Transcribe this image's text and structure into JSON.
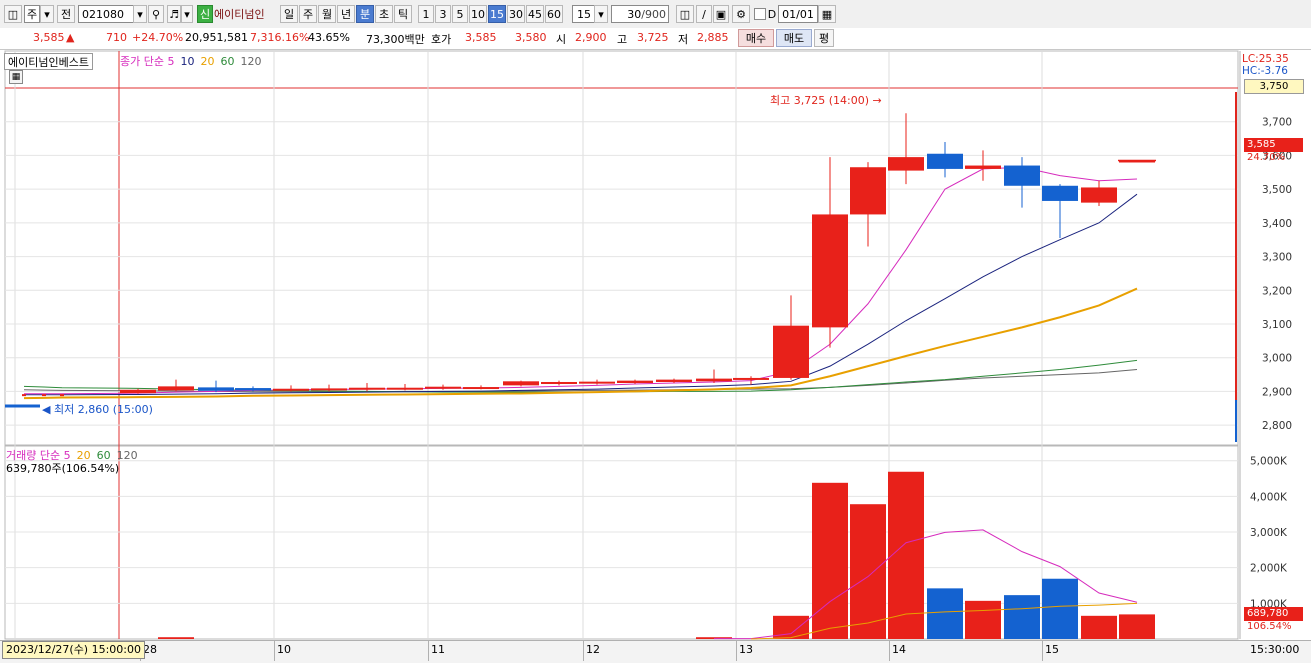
{
  "toolbar": {
    "market": "주",
    "prev_label": "전",
    "code": "021080",
    "badge": "신",
    "stock_name": "에이티넘인",
    "periods": [
      "일",
      "주",
      "월",
      "년",
      "분",
      "초",
      "틱"
    ],
    "selected_period": "분",
    "intervals": [
      "1",
      "3",
      "5",
      "10",
      "15",
      "30",
      "45",
      "60"
    ],
    "selected_interval": "15",
    "interval_select": "15",
    "count": "30",
    "count_max": "/900",
    "d_label": "D",
    "date": "01/01"
  },
  "quote": {
    "price": "3,585",
    "arrow": "▲",
    "change": "710",
    "change_pct": "+24.70%",
    "volume": "20,951,581",
    "volume_pct": "7,316.16%",
    "turnover": "43.65%",
    "amount": "73,300백만",
    "hoga_label": "호가",
    "ask": "3,585",
    "bid": "3,580",
    "open_label": "시",
    "open": "2,900",
    "high_label": "고",
    "high": "3,725",
    "low_label": "저",
    "low": "2,885",
    "buy_label": "매수",
    "sell_label": "매도",
    "eval_label": "평"
  },
  "price_panel": {
    "title": "에이티넘인베스트",
    "legend": {
      "name": "종가 단순",
      "periods": [
        "5",
        "10",
        "20",
        "60",
        "120"
      ]
    },
    "lc": "LC:25.35",
    "hc": "HC:-3.76",
    "top_box": "3,750",
    "price_tag": "3,585",
    "pct_tag": "24.70%",
    "high_note": "최고 3,725 (14:00)",
    "low_note": "최저 2,860 (15:00)"
  },
  "volume_panel": {
    "legend": {
      "name": "거래량",
      "method": "단순",
      "periods": [
        "5",
        "20",
        "60",
        "120"
      ]
    },
    "current": "639,780주(106.54%)",
    "tag": "689,780",
    "pct": "106.54%"
  },
  "xaxis": {
    "cursor_label": "2023/12/27(수) 15:00:00",
    "first_day": "28",
    "end_time": "15:30:00"
  },
  "colors": {
    "up": "#e8211a",
    "down": "#1462d0",
    "ma5": "#d62bbd",
    "ma10": "#1a237e",
    "ma20": "#e8a000",
    "ma60": "#2e8b3a",
    "ma120": "#666666"
  },
  "chart_data": [
    {
      "type": "candlestick",
      "title": "에이티넘인베스트",
      "ylim": [
        2750,
        3800
      ],
      "y_ticks": [
        2800,
        2900,
        3000,
        3100,
        3200,
        3300,
        3400,
        3500,
        3600,
        3700
      ],
      "x_ticks": [
        "28",
        "10",
        "11",
        "12",
        "13",
        "14",
        "15"
      ],
      "candles": [
        {
          "o": 2892,
          "c": 2892,
          "h": 2892,
          "l": 2892
        },
        {
          "o": 2892,
          "c": 2892,
          "h": 2892,
          "l": 2892
        },
        {
          "o": 2892,
          "c": 2892,
          "h": 2892,
          "l": 2892
        },
        {
          "o": 2895,
          "c": 2905,
          "h": 2908,
          "l": 2893
        },
        {
          "o": 2903,
          "c": 2915,
          "h": 2935,
          "l": 2900
        },
        {
          "o": 2912,
          "c": 2902,
          "h": 2932,
          "l": 2898
        },
        {
          "o": 2910,
          "c": 2903,
          "h": 2915,
          "l": 2900
        },
        {
          "o": 2905,
          "c": 2908,
          "h": 2918,
          "l": 2900
        },
        {
          "o": 2905,
          "c": 2909,
          "h": 2920,
          "l": 2900
        },
        {
          "o": 2905,
          "c": 2911,
          "h": 2925,
          "l": 2900
        },
        {
          "o": 2907,
          "c": 2911,
          "h": 2922,
          "l": 2903
        },
        {
          "o": 2910,
          "c": 2914,
          "h": 2920,
          "l": 2905
        },
        {
          "o": 2910,
          "c": 2913,
          "h": 2918,
          "l": 2906
        },
        {
          "o": 2918,
          "c": 2930,
          "h": 2932,
          "l": 2915
        },
        {
          "o": 2922,
          "c": 2928,
          "h": 2932,
          "l": 2918
        },
        {
          "o": 2925,
          "c": 2929,
          "h": 2935,
          "l": 2920
        },
        {
          "o": 2925,
          "c": 2932,
          "h": 2935,
          "l": 2922
        },
        {
          "o": 2928,
          "c": 2935,
          "h": 2938,
          "l": 2925
        },
        {
          "o": 2930,
          "c": 2938,
          "h": 2965,
          "l": 2925
        },
        {
          "o": 2935,
          "c": 2940,
          "h": 2945,
          "l": 2920
        },
        {
          "o": 2940,
          "c": 3095,
          "h": 3185,
          "l": 2935
        },
        {
          "o": 3090,
          "c": 3425,
          "h": 3595,
          "l": 3030
        },
        {
          "o": 3425,
          "c": 3565,
          "h": 3580,
          "l": 3330
        },
        {
          "o": 3555,
          "c": 3595,
          "h": 3725,
          "l": 3515
        },
        {
          "o": 3605,
          "c": 3560,
          "h": 3640,
          "l": 3535
        },
        {
          "o": 3560,
          "c": 3570,
          "h": 3615,
          "l": 3525
        },
        {
          "o": 3570,
          "c": 3510,
          "h": 3595,
          "l": 3445
        },
        {
          "o": 3510,
          "c": 3465,
          "h": 3515,
          "l": 3355
        },
        {
          "o": 3460,
          "c": 3505,
          "h": 3525,
          "l": 3450
        },
        {
          "o": 3585,
          "c": 3585,
          "h": 3585,
          "l": 3585
        }
      ],
      "ma": {
        "ma5": [
          2893,
          2893,
          2893,
          2895,
          2898,
          2900,
          2903,
          2905,
          2906,
          2907,
          2908,
          2909,
          2910,
          2912,
          2915,
          2918,
          2922,
          2925,
          2928,
          2932,
          2960,
          3040,
          3160,
          3320,
          3500,
          3560,
          3565,
          3540,
          3525,
          3530
        ],
        "ma10": [
          2890,
          2890,
          2890,
          2891,
          2892,
          2893,
          2895,
          2896,
          2897,
          2898,
          2899,
          2900,
          2901,
          2903,
          2905,
          2907,
          2910,
          2913,
          2916,
          2920,
          2930,
          2975,
          3040,
          3110,
          3175,
          3240,
          3300,
          3350,
          3400,
          3485
        ],
        "ma20": [
          2880,
          2881,
          2882,
          2883,
          2884,
          2885,
          2887,
          2888,
          2889,
          2890,
          2891,
          2892,
          2893,
          2894,
          2896,
          2898,
          2900,
          2903,
          2906,
          2910,
          2918,
          2945,
          2975,
          3005,
          3035,
          3062,
          3090,
          3120,
          3155,
          3205
        ],
        "ma60": [
          2915,
          2913,
          2911,
          2909,
          2907,
          2905,
          2903,
          2902,
          2901,
          2900,
          2899,
          2898,
          2898,
          2898,
          2898,
          2898,
          2899,
          2900,
          2900,
          2901,
          2905,
          2912,
          2920,
          2928,
          2935,
          2945,
          2955,
          2965,
          2978,
          2992
        ],
        "ma120": [
          2905,
          2904,
          2903,
          2902,
          2901,
          2900,
          2899,
          2899,
          2899,
          2899,
          2900,
          2900,
          2900,
          2901,
          2902,
          2903,
          2904,
          2905,
          2906,
          2907,
          2908,
          2912,
          2918,
          2925,
          2933,
          2940,
          2945,
          2950,
          2955,
          2965
        ]
      }
    },
    {
      "type": "bar",
      "title": "거래량",
      "ylim": [
        0,
        5300
      ],
      "y_ticks": [
        "1,000K",
        "2,000K",
        "3,000K",
        "4,000K",
        "5,000K"
      ],
      "values": [
        0,
        0,
        0,
        0,
        50,
        0,
        0,
        0,
        0,
        0,
        0,
        0,
        0,
        0,
        0,
        0,
        0,
        0,
        50,
        0,
        650,
        4380,
        3780,
        4690,
        1420,
        1070,
        1230,
        1690,
        650,
        690
      ],
      "ma5": [
        0,
        0,
        0,
        0,
        10,
        10,
        10,
        10,
        10,
        0,
        0,
        0,
        0,
        0,
        0,
        0,
        0,
        0,
        10,
        10,
        150,
        1050,
        1750,
        2700,
        2990,
        3060,
        2450,
        2030,
        1290,
        1030
      ],
      "ma20": [
        0,
        0,
        0,
        0,
        0,
        0,
        0,
        0,
        0,
        0,
        0,
        0,
        0,
        0,
        0,
        0,
        0,
        0,
        0,
        0,
        40,
        300,
        450,
        700,
        760,
        800,
        850,
        920,
        950,
        1000
      ]
    }
  ]
}
